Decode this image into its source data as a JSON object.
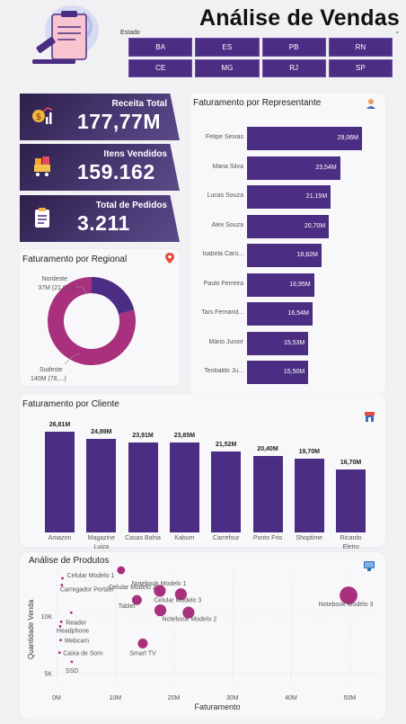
{
  "header": {
    "title": "Análise de Vendas"
  },
  "slicer": {
    "label": "Estado",
    "chevron": "⌄",
    "options": [
      "BA",
      "ES",
      "PB",
      "RN",
      "CE",
      "MG",
      "RJ",
      "SP"
    ]
  },
  "kpis": [
    {
      "label": "Receita Total",
      "value": "177,77M",
      "icon": "money-chart-icon"
    },
    {
      "label": "Itens Vendidos",
      "value": "159.162",
      "icon": "cart-icon"
    },
    {
      "label": "Total de Pedidos",
      "value": "3.211",
      "icon": "clipboard-icon"
    }
  ],
  "rep_card": {
    "title": "Faturamento por Representante",
    "icon": "person-icon"
  },
  "regional_card": {
    "title": "Faturamento por Regional",
    "icon": "map-pin-icon"
  },
  "cliente_card": {
    "title": "Faturamento por Cliente",
    "icon": "store-icon"
  },
  "produtos_card": {
    "title": "Análise de Produtos",
    "icon": "monitor-icon"
  },
  "colors": {
    "accent": "#4b2e83",
    "pie_nordeste": "#4b2e83",
    "pie_sudeste": "#a8307c",
    "scatter": "#a8307c"
  },
  "chart_data": [
    {
      "type": "bar",
      "title": "Faturamento por Representante",
      "orientation": "horizontal",
      "categories": [
        "Felipe Seixas",
        "Maria Silva",
        "Lucas Souza",
        "Alex Souza",
        "Isabela Caro...",
        "Paulo Ferreira",
        "Taís Fernand...",
        "Mário Junior",
        "Teobaldo Ju..."
      ],
      "values": [
        29.06,
        23.54,
        21.15,
        20.7,
        18.82,
        16.95,
        16.54,
        15.53,
        15.5
      ],
      "labels": [
        "29,06M",
        "23,54M",
        "21,15M",
        "20,70M",
        "18,82M",
        "16,95M",
        "16,54M",
        "15,53M",
        "15,50M"
      ]
    },
    {
      "type": "pie",
      "title": "Faturamento por Regional",
      "categories": [
        "Nordeste",
        "Sudeste"
      ],
      "values": [
        37,
        140
      ],
      "labels": [
        "37M (21,0...)",
        "140M (78,...)"
      ]
    },
    {
      "type": "bar",
      "title": "Faturamento por Cliente",
      "categories": [
        "Amazon",
        "Magazine Luiza",
        "Casas Bahia",
        "Kabum",
        "Carrefour",
        "Ponto Frio",
        "Shoptime",
        "Ricardo Eletro"
      ],
      "values": [
        26.81,
        24.89,
        23.91,
        23.85,
        21.52,
        20.4,
        19.7,
        16.7
      ],
      "labels": [
        "26,81M",
        "24,89M",
        "23,91M",
        "23,85M",
        "21,52M",
        "20,40M",
        "19,70M",
        "16,70M"
      ]
    },
    {
      "type": "scatter",
      "title": "Análise de Produtos",
      "xlabel": "Faturamento",
      "ylabel": "Quantidade Venda",
      "xlim": [
        0,
        55
      ],
      "ylim": [
        4500,
        14000
      ],
      "xticks": [
        "0M",
        "10M",
        "20M",
        "30M",
        "40M",
        "50M"
      ],
      "yticks": [
        "5K",
        "10K"
      ],
      "points": [
        {
          "name": "Celular Modelo 1",
          "x": 1.0,
          "y": 13300,
          "size": 1
        },
        {
          "name": "Carregador Portátil",
          "x": 0.9,
          "y": 12700,
          "size": 1
        },
        {
          "name": "Notebook Modelo 1",
          "x": 11,
          "y": 14000,
          "size": 4
        },
        {
          "name": "Celular Modelo 2",
          "x": 17.6,
          "y": 12200,
          "size": 6
        },
        {
          "name": "Celular Modelo 3",
          "x": 21.2,
          "y": 11900,
          "size": 6
        },
        {
          "name": "Tablet",
          "x": 13.7,
          "y": 11400,
          "size": 5
        },
        {
          "name": "Notebook Modelo 2",
          "x": 17.7,
          "y": 10500,
          "size": 6
        },
        {
          "name": "Notebook Modelo 3",
          "x": 49.8,
          "y": 11800,
          "size": 9
        },
        {
          "name": "",
          "x": 22.5,
          "y": 10300,
          "size": 6
        },
        {
          "name": "Reader",
          "x": 0.8,
          "y": 9500,
          "size": 1
        },
        {
          "name": "Headphone",
          "x": 0.6,
          "y": 9100,
          "size": 1
        },
        {
          "name": "",
          "x": 2.5,
          "y": 10300,
          "size": 1
        },
        {
          "name": "Webcam",
          "x": 0.7,
          "y": 7900,
          "size": 1
        },
        {
          "name": "Smart TV",
          "x": 14.7,
          "y": 7600,
          "size": 5
        },
        {
          "name": "Caixa de Som",
          "x": 0.5,
          "y": 6800,
          "size": 1
        },
        {
          "name": "SSD",
          "x": 2.6,
          "y": 6000,
          "size": 1
        }
      ]
    }
  ]
}
